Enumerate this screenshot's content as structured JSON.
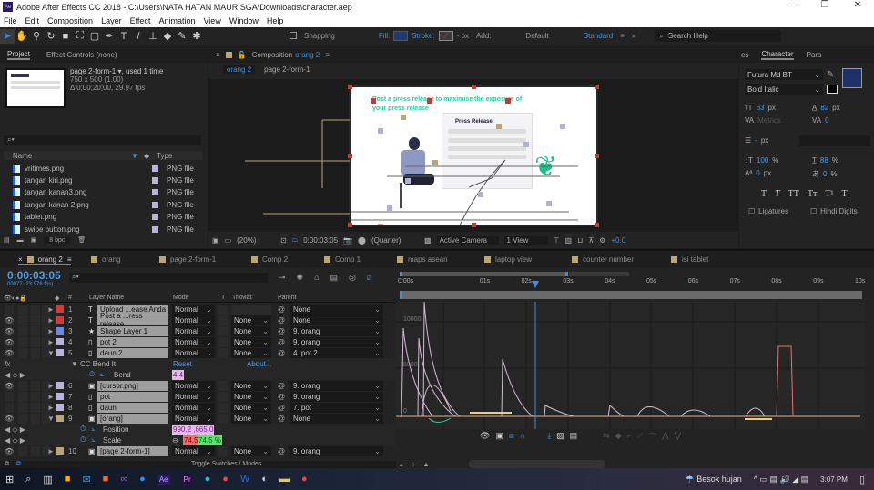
{
  "window": {
    "title": "Adobe After Effects CC 2018 - C:\\Users\\NATA HATAN MAURISGA\\Downloads\\character.aep",
    "app_icon": "Ae"
  },
  "menu": [
    "File",
    "Edit",
    "Composition",
    "Layer",
    "Effect",
    "Animation",
    "View",
    "Window",
    "Help"
  ],
  "toolbar": {
    "snapping": "Snapping",
    "fill": "Fill:",
    "stroke": "Stroke:",
    "px": "- px",
    "add": "Add:",
    "workspace_default": "Default",
    "workspace_standard": "Standard",
    "search_placeholder": "Search Help",
    "fill_color": "#1f3a7a"
  },
  "project": {
    "tab": "Project",
    "effect_controls": "Effect Controls (none)",
    "item_name": "page 2-form-1",
    "used": ", used 1 time",
    "dims": "750 x 500 (1.00)",
    "duration": "Δ 0;00;20;00, 29.97 fps",
    "col_name": "Name",
    "col_type": "Type",
    "bpc": "8 bpc",
    "items": [
      {
        "name": "vritimes.png",
        "type": "PNG file"
      },
      {
        "name": "tangan kiri.png",
        "type": "PNG file"
      },
      {
        "name": "tangan kanan3.png",
        "type": "PNG file"
      },
      {
        "name": "tangan kanan 2.png",
        "type": "PNG file"
      },
      {
        "name": "tablet.png",
        "type": "PNG file"
      },
      {
        "name": "swipe button.png",
        "type": "PNG file"
      }
    ]
  },
  "composition": {
    "tab_prefix": "Composition",
    "tab_name": "orang 2",
    "breadcrumb": [
      "orang 2",
      "page 2-form-1"
    ],
    "canvas_text": "Post a press release to maximise the exposure of your press release",
    "form_title": "Press Release",
    "footer": {
      "zoom": "(20%)",
      "timecode": "0:00:03:05",
      "resolution": "(Quarter)",
      "camera": "Active Camera",
      "views": "1 View",
      "exposure": "+0.0"
    }
  },
  "character": {
    "tab_prev": "es",
    "tab": "Character",
    "tab_next": "Para",
    "font": "Futura Md BT",
    "style": "Bold Italic",
    "size": "63",
    "leading": "82",
    "kerning": "Metrics",
    "tracking": "0",
    "stroke_width": "-",
    "vscale": "100",
    "hscale": "88",
    "baseline": "0",
    "tsume": "0",
    "unit_px": "px",
    "unit_pct": "%",
    "ligatures": "Ligatures",
    "hindi": "Hindi Digits",
    "fill_color": "#1f2f6a"
  },
  "timeline": {
    "tabs": [
      "orang 2",
      "orang",
      "page 2-form-1",
      "Comp 2",
      "Comp 1",
      "maps asean",
      "laptop view",
      "counter number",
      "isi tablet"
    ],
    "timecode": "0:00:03:05",
    "frame": "00077 (23.976 fps)",
    "columns": {
      "num": "#",
      "name": "Layer Name",
      "mode": "Mode",
      "t": "T",
      "trkmat": "TrkMat",
      "parent": "Parent"
    },
    "ruler": [
      "0:00s",
      "01s",
      "02s",
      "03s",
      "04s",
      "05s",
      "06s",
      "07s",
      "08s",
      "09s",
      "10s"
    ],
    "graph_labels": [
      "10000",
      "5000",
      "0"
    ],
    "toggle": "Toggle Switches / Modes",
    "rows": [
      {
        "kind": "layer",
        "num": "1",
        "icon": "T",
        "name": "Upload ...ease Anda",
        "mode": "Normal",
        "trk": "",
        "parent": "None",
        "color": "#d03c3c",
        "eye": false
      },
      {
        "kind": "layer",
        "num": "2",
        "icon": "T",
        "name": "Post a ...ress release",
        "mode": "Normal",
        "trk": "None",
        "parent": "None",
        "color": "#d03c3c",
        "eye": true
      },
      {
        "kind": "layer",
        "num": "3",
        "icon": "★",
        "name": "Shape Layer 1",
        "mode": "Normal",
        "trk": "None",
        "parent": "9. orang",
        "color": "#6f86e6",
        "eye": true
      },
      {
        "kind": "layer",
        "num": "4",
        "icon": "▯",
        "name": "pot 2",
        "mode": "Normal",
        "trk": "None",
        "parent": "9. orang",
        "color": "#b8b4dc",
        "eye": true
      },
      {
        "kind": "layer",
        "num": "5",
        "icon": "▯",
        "name": "daun 2",
        "mode": "Normal",
        "trk": "None",
        "parent": "4. pot 2",
        "color": "#b8b4dc",
        "eye": true,
        "open": true
      },
      {
        "kind": "effect",
        "name": "CC Bend It",
        "reset": "Reset",
        "about": "About..."
      },
      {
        "kind": "prop",
        "name": "Bend",
        "value": "4.4"
      },
      {
        "kind": "layer",
        "num": "6",
        "icon": "▣",
        "name": "[cursor.png]",
        "mode": "Normal",
        "trk": "None",
        "parent": "9. orang",
        "color": "#b8b4dc",
        "eye": true
      },
      {
        "kind": "layer",
        "num": "7",
        "icon": "▯",
        "name": "pot",
        "mode": "Normal",
        "trk": "None",
        "parent": "9. orang",
        "color": "#b8b4dc",
        "eye": false
      },
      {
        "kind": "layer",
        "num": "8",
        "icon": "▯",
        "name": "daun",
        "mode": "Normal",
        "trk": "None",
        "parent": "7. pot",
        "color": "#b8b4dc",
        "eye": false
      },
      {
        "kind": "layer",
        "num": "9",
        "icon": "▣",
        "name": "[orang]",
        "mode": "Normal",
        "trk": "None",
        "parent": "None",
        "color": "#b9a57c",
        "eye": true,
        "open": true
      },
      {
        "kind": "prop",
        "name": "Position",
        "value": "990.2 ,665.0"
      },
      {
        "kind": "scale",
        "name": "Scale",
        "v1": "74.5",
        "v2": "74.5 %"
      },
      {
        "kind": "layer",
        "num": "10",
        "icon": "▣",
        "name": "[page 2-form-1]",
        "mode": "Normal",
        "trk": "None",
        "parent": "9. orang",
        "color": "#b9a57c",
        "eye": true
      }
    ]
  },
  "taskbar": {
    "weather": "Besok hujan",
    "time": "3:07 PM"
  }
}
